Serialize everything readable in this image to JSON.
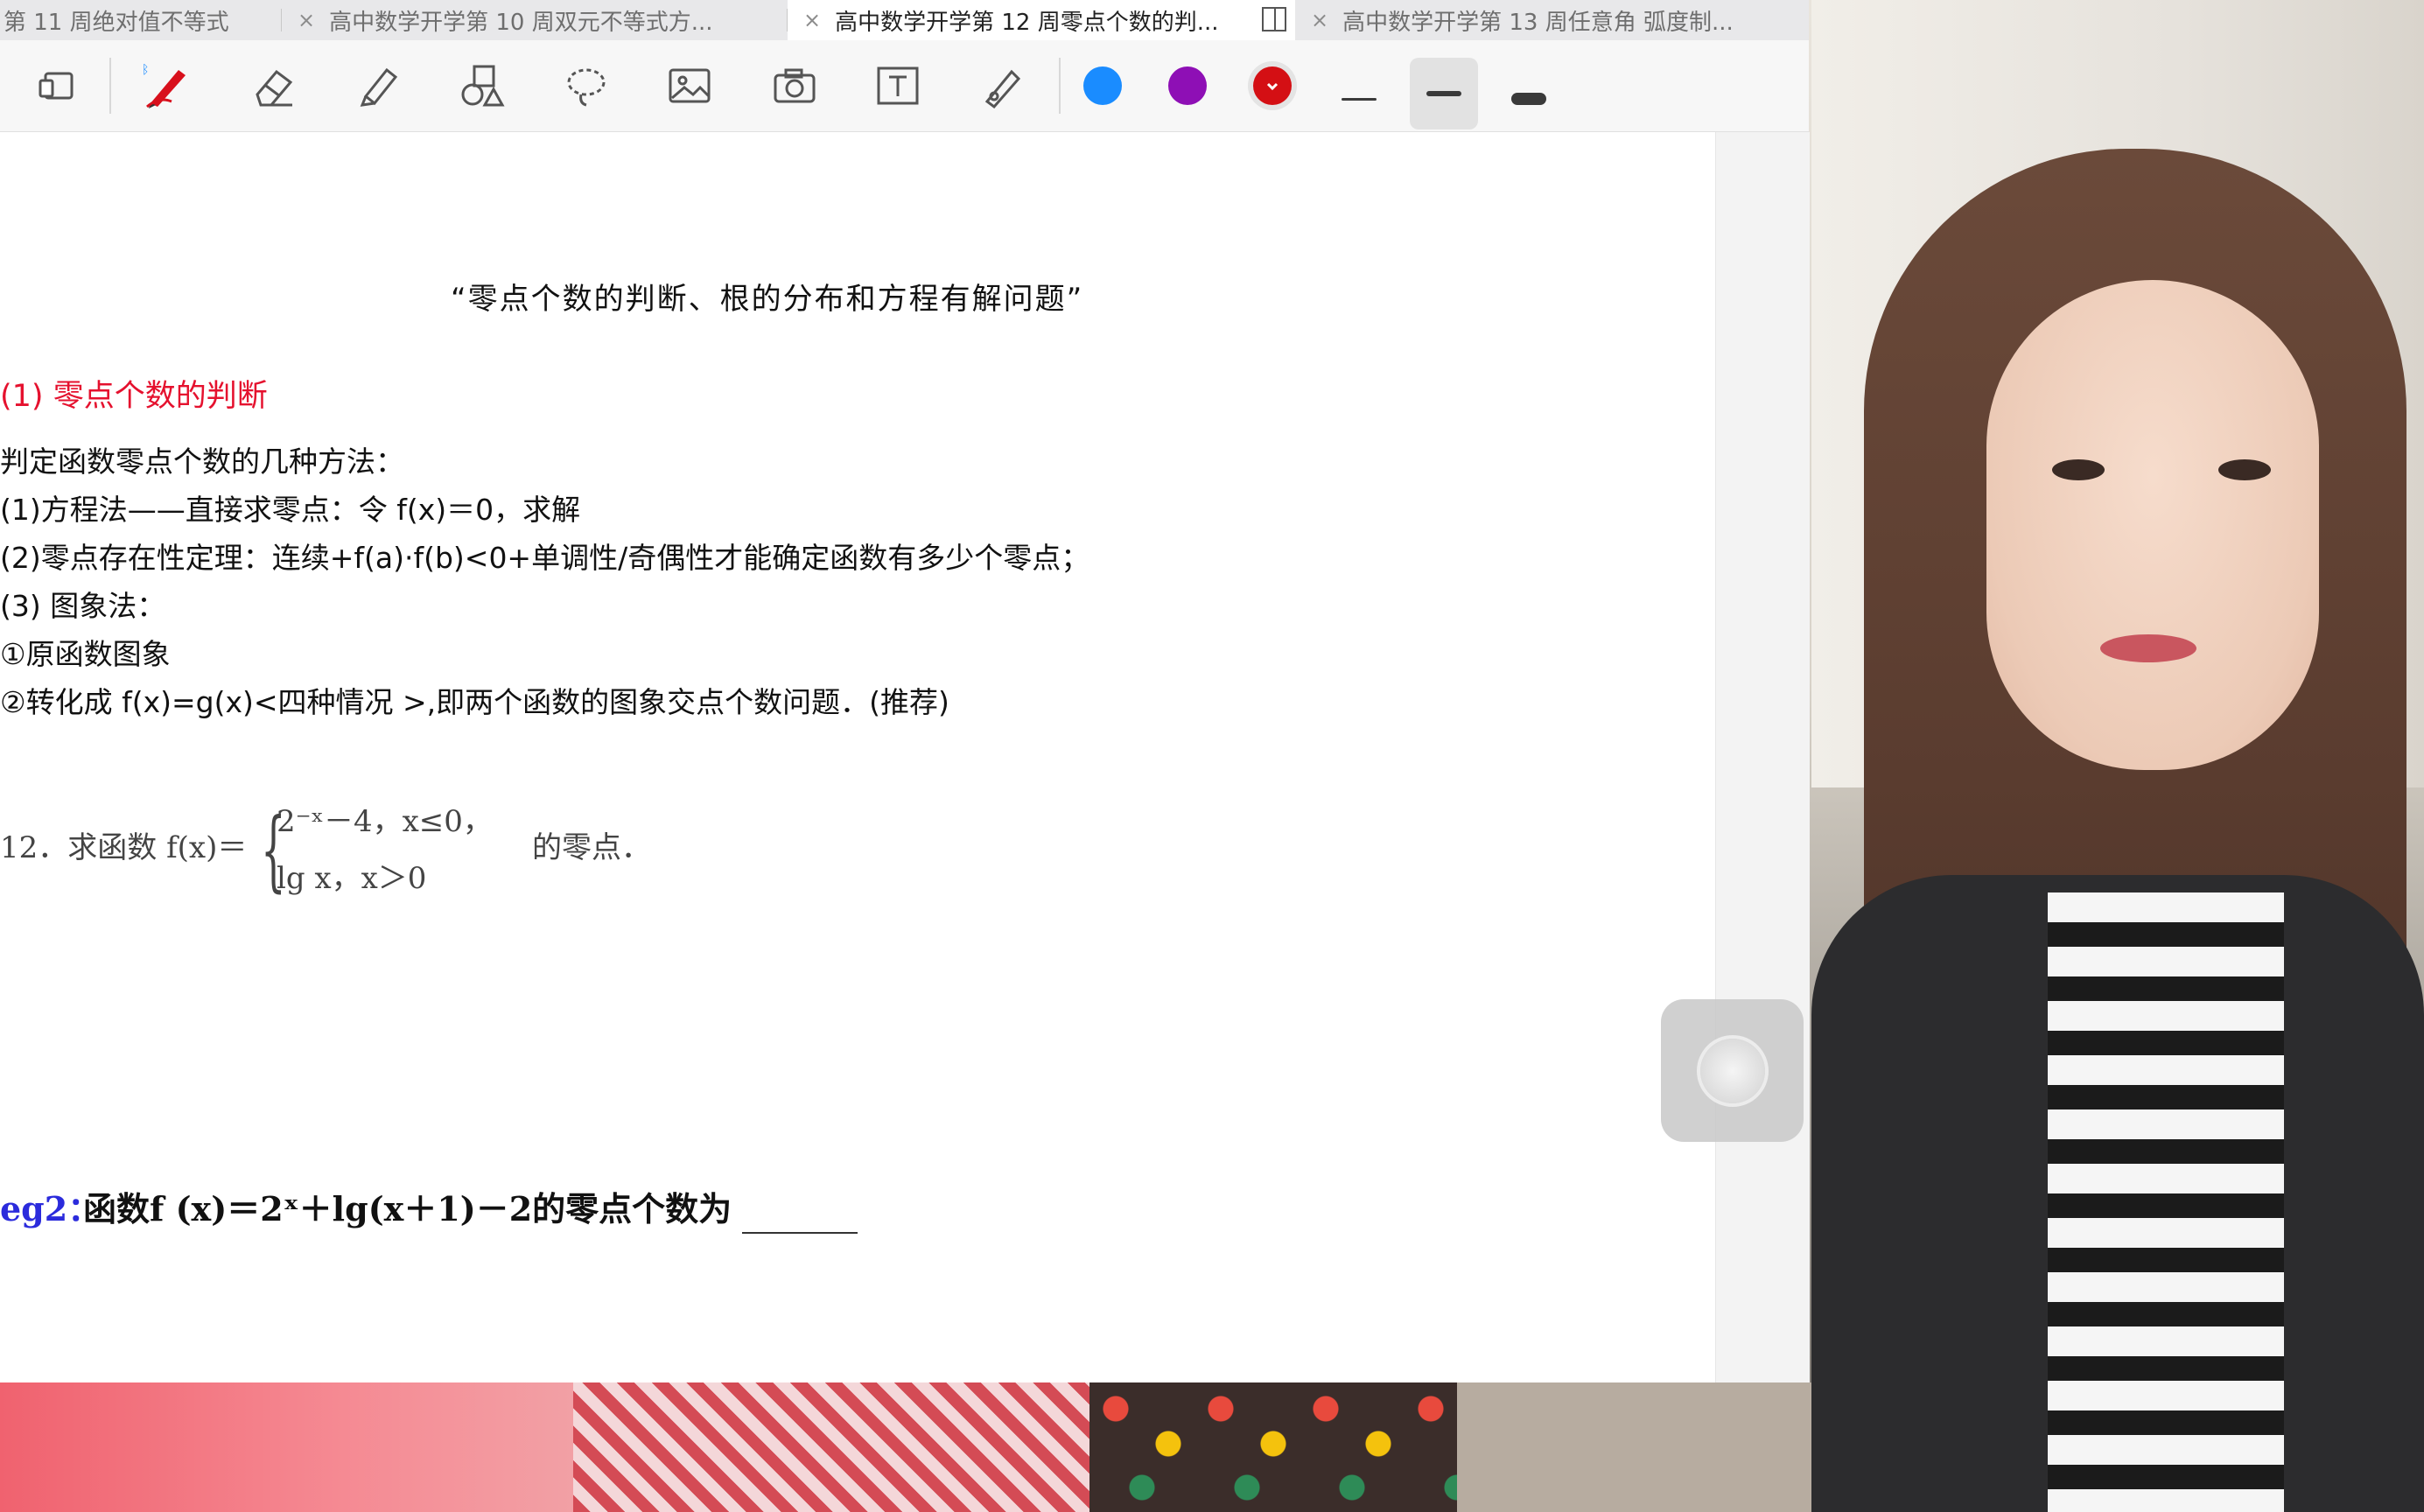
{
  "tabs": [
    {
      "label": "第 11 周绝对值不等式",
      "active": false
    },
    {
      "label": "高中数学开学第 10 周双元不等式方...",
      "active": false
    },
    {
      "label": "高中数学开学第 12 周零点个数的判...",
      "active": true
    },
    {
      "label": "高中数学开学第 13 周任意角 弧度制...",
      "active": false
    }
  ],
  "close_glyph": "×",
  "toolbar": {
    "tools": [
      "convert-icon",
      "pen-icon",
      "eraser-icon",
      "highlighter-icon",
      "shapes-icon",
      "lasso-icon",
      "image-icon",
      "camera-icon",
      "text-icon",
      "laser-pointer-icon"
    ],
    "colors": [
      "#1a8cff",
      "#8e0fb5",
      "#d40f14"
    ],
    "selected_color": "#d40f14",
    "stroke_sizes": [
      "thin",
      "medium",
      "thick"
    ],
    "selected_stroke": "medium"
  },
  "document": {
    "title": "“零点个数的判断、根的分布和方程有解问题”",
    "section1": "(1) 零点个数的判断",
    "lines": [
      "判定函数零点个数的几种方法：",
      "(1)方程法——直接求零点：令 f(x)＝0，求解",
      "(2)零点存在性定理：连续+f(a)·f(b)<0+单调性/奇偶性才能确定函数有多少个零点；",
      "(3) 图象法：",
      "①原函数图象",
      "②转化成 f(x)=g(x)<四种情况 >,即两个函数的图象交点个数问题．(推荐)"
    ],
    "example12": {
      "label": "12．求函数 f(x)＝",
      "case1": "2⁻ˣ－4，x≤0，",
      "case2": "lg x，x＞0",
      "tail": "的零点．"
    },
    "eg2": {
      "label": "eg2：",
      "text": "函数f (x)＝2ˣ＋lg(x＋1)－2的零点个数为"
    }
  }
}
